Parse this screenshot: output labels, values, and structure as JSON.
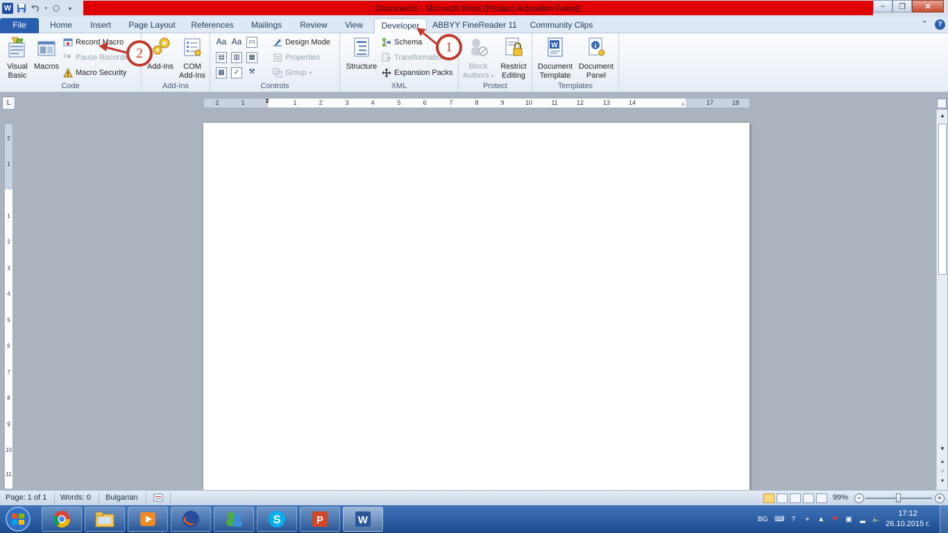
{
  "window": {
    "title": "Document1 - Microsoft Word (Product Activation Failed)",
    "app_icon": "W",
    "minimize_icon": "–",
    "restore_icon": "❐",
    "close_icon": "✕"
  },
  "tabs": [
    {
      "label": "File"
    },
    {
      "label": "Home"
    },
    {
      "label": "Insert"
    },
    {
      "label": "Page Layout"
    },
    {
      "label": "References"
    },
    {
      "label": "Mailings"
    },
    {
      "label": "Review"
    },
    {
      "label": "View"
    },
    {
      "label": "Developer"
    },
    {
      "label": "ABBYY FineReader 11"
    },
    {
      "label": "Community Clips"
    }
  ],
  "ribbon": {
    "code": {
      "label": "Code",
      "visual_basic": "Visual Basic",
      "macros": "Macros",
      "record_macro": "Record Macro",
      "pause_recording": "Pause Recording",
      "macro_security": "Macro Security"
    },
    "addins": {
      "label": "Add-Ins",
      "add_ins": "Add-Ins",
      "com_add_ins": "COM Add-Ins"
    },
    "controls": {
      "label": "Controls",
      "design_mode": "Design Mode",
      "properties": "Properties",
      "group": "Group"
    },
    "xml": {
      "label": "XML",
      "structure": "Structure",
      "schema": "Schema",
      "transformation": "Transformation",
      "expansion_packs": "Expansion Packs"
    },
    "protect": {
      "label": "Protect",
      "block_authors": "Block Authors",
      "restrict_editing": "Restrict Editing"
    },
    "templates": {
      "label": "Templates",
      "document_template": "Document Template",
      "document_panel": "Document Panel"
    }
  },
  "ruler": {
    "h_numbers": [
      "2",
      "1",
      "",
      "1",
      "2",
      "3",
      "4",
      "5",
      "6",
      "7",
      "8",
      "9",
      "10",
      "11",
      "12",
      "13",
      "14",
      "",
      "17",
      "18"
    ],
    "v_numbers": [
      "2",
      "1",
      "",
      "1",
      "2",
      "3",
      "4",
      "5",
      "6",
      "7",
      "8",
      "9",
      "10",
      "11"
    ]
  },
  "statusbar": {
    "page": "Page: 1 of 1",
    "words": "Words: 0",
    "language": "Bulgarian",
    "zoom": "99%",
    "zoom_value_percent": 99
  },
  "taskbar": {
    "language": "BG",
    "time": "17:12",
    "date": "26.10.2015 г."
  },
  "annotations": [
    {
      "label": "1"
    },
    {
      "label": "2"
    }
  ],
  "colors": {
    "title_highlight": "#e00000",
    "file_tab": "#2a5fb0",
    "annotation": "#c0392b"
  }
}
